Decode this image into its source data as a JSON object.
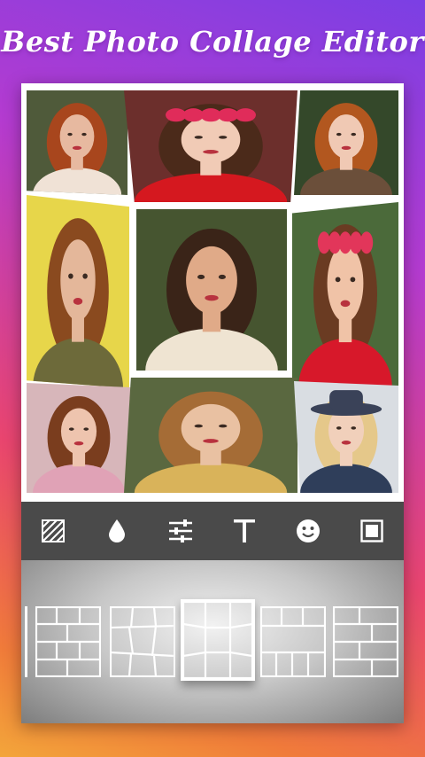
{
  "app": {
    "title": "Best Photo Collage Editor"
  },
  "collage": {
    "photos": [
      {
        "name": "photo-1",
        "bg": "#4f5a3a",
        "hair": "#a8461d",
        "skin": "#e7b9a0",
        "top": "#f0e2d6"
      },
      {
        "name": "photo-2",
        "bg": "#6c2f2c",
        "hair": "#4b2a1a",
        "skin": "#f1cbb6",
        "top": "#d5181f",
        "crown": "#e02c5a"
      },
      {
        "name": "photo-3",
        "bg": "#34482a",
        "hair": "#b2571f",
        "skin": "#f0c9b4",
        "top": "#6b4f3a"
      },
      {
        "name": "photo-4",
        "bg": "#e7d64a",
        "hair": "#8a4a1f",
        "skin": "#e4b79a",
        "top": "#6d6a3a"
      },
      {
        "name": "photo-5",
        "bg": "#465530",
        "hair": "#3a2418",
        "skin": "#e0aa88",
        "top": "#efe4d2"
      },
      {
        "name": "photo-6",
        "bg": "#4b6a3a",
        "hair": "#6a3b22",
        "skin": "#f0c3a7",
        "top": "#d7182a",
        "crown": "#e2365a"
      },
      {
        "name": "photo-7",
        "bg": "#d7b6ba",
        "hair": "#7a3d1e",
        "skin": "#eec4ae",
        "top": "#e0a2b6"
      },
      {
        "name": "photo-8",
        "bg": "#5a6840",
        "hair": "#a56c36",
        "skin": "#e9c1a2",
        "top": "#d9b35a"
      },
      {
        "name": "photo-9",
        "bg": "#d9dde2",
        "hair": "#e5c88a",
        "skin": "#f1d0bb",
        "top": "#2f3e5a",
        "hat": "#3a4258"
      }
    ]
  },
  "toolbar": {
    "tools": [
      {
        "name": "background-pattern-icon"
      },
      {
        "name": "color-drop-icon"
      },
      {
        "name": "adjust-sliders-icon"
      },
      {
        "name": "text-icon"
      },
      {
        "name": "sticker-smile-icon"
      },
      {
        "name": "border-frame-icon"
      }
    ]
  },
  "layouts": {
    "selected_index": 2,
    "items": [
      {
        "name": "layout-brick"
      },
      {
        "name": "layout-tilted"
      },
      {
        "name": "layout-perspective"
      },
      {
        "name": "layout-mixed-grid"
      },
      {
        "name": "layout-columns"
      }
    ]
  },
  "colors": {
    "toolbar_bg": "#4a4a4a",
    "icon": "#ffffff",
    "frame": "#ffffff",
    "gradient_top": "#7b3fe4",
    "gradient_bottom": "#f3a53a"
  }
}
